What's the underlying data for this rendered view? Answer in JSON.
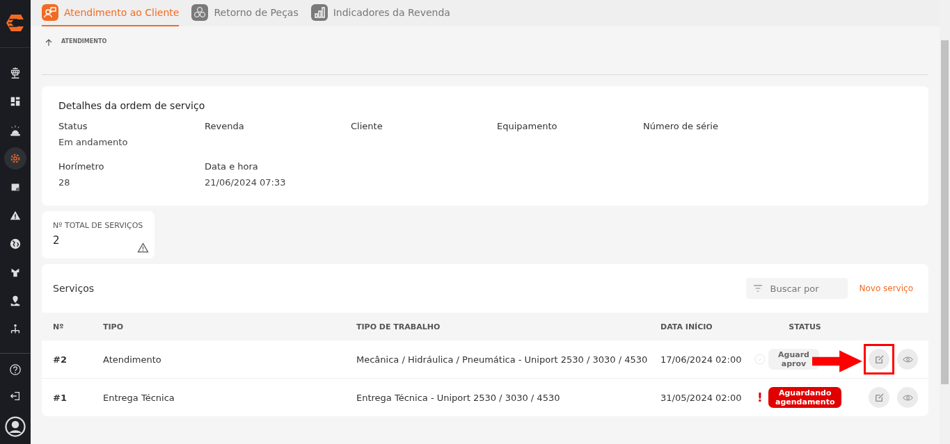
{
  "sidebar": {
    "items": [
      {
        "selected": false
      },
      {
        "selected": false
      },
      {
        "selected": false
      },
      {
        "selected": true
      },
      {
        "selected": false
      },
      {
        "selected": false
      },
      {
        "selected": false
      },
      {
        "selected": false
      },
      {
        "selected": false
      },
      {
        "selected": false
      }
    ]
  },
  "tabs": [
    {
      "label": "Atendimento ao Cliente",
      "selected": true
    },
    {
      "label": "Retorno de Peças",
      "selected": false
    },
    {
      "label": "Indicadores da Revenda",
      "selected": false
    }
  ],
  "breadcrumb": "ATENDIMENTO",
  "details": {
    "title": "Detalhes da ordem de serviço",
    "fields": [
      {
        "label": "Status",
        "value": "Em andamento"
      },
      {
        "label": "Revenda"
      },
      {
        "label": "Cliente"
      },
      {
        "label": "Equipamento"
      },
      {
        "label": "Número de série"
      },
      {
        "label": "Horímetro",
        "value": "28"
      },
      {
        "label": "Data e hora",
        "value": "21/06/2024 07:33"
      }
    ]
  },
  "total": {
    "label": "Nº TOTAL DE SERVIÇOS",
    "value": "2"
  },
  "services": {
    "title": "Serviços",
    "search": {
      "placeholder": "Buscar por"
    },
    "new_button": "Novo serviço",
    "columns": [
      "Nº",
      "TIPO",
      "TIPO DE TRABALHO",
      "DATA INÍCIO",
      "STATUS"
    ],
    "rows": [
      {
        "number": "#2",
        "type": "Atendimento",
        "work": "Mecânica / Hidráulica / Pneumática - Uniport 2530 / 3030 / 4530",
        "date": "17/06/2024 02:00",
        "status": "Aguard\naprov",
        "kind": "pending-approval",
        "highlighted": true
      },
      {
        "number": "#1",
        "type": "Entrega Técnica",
        "work": "Entrega Técnica - Uniport 2530 / 3030 / 4530",
        "date": "31/05/2024 02:00",
        "status": "Aguardando\nagendamento",
        "marker": "!",
        "kind": "pending-schedule",
        "highlighted": false
      }
    ]
  }
}
